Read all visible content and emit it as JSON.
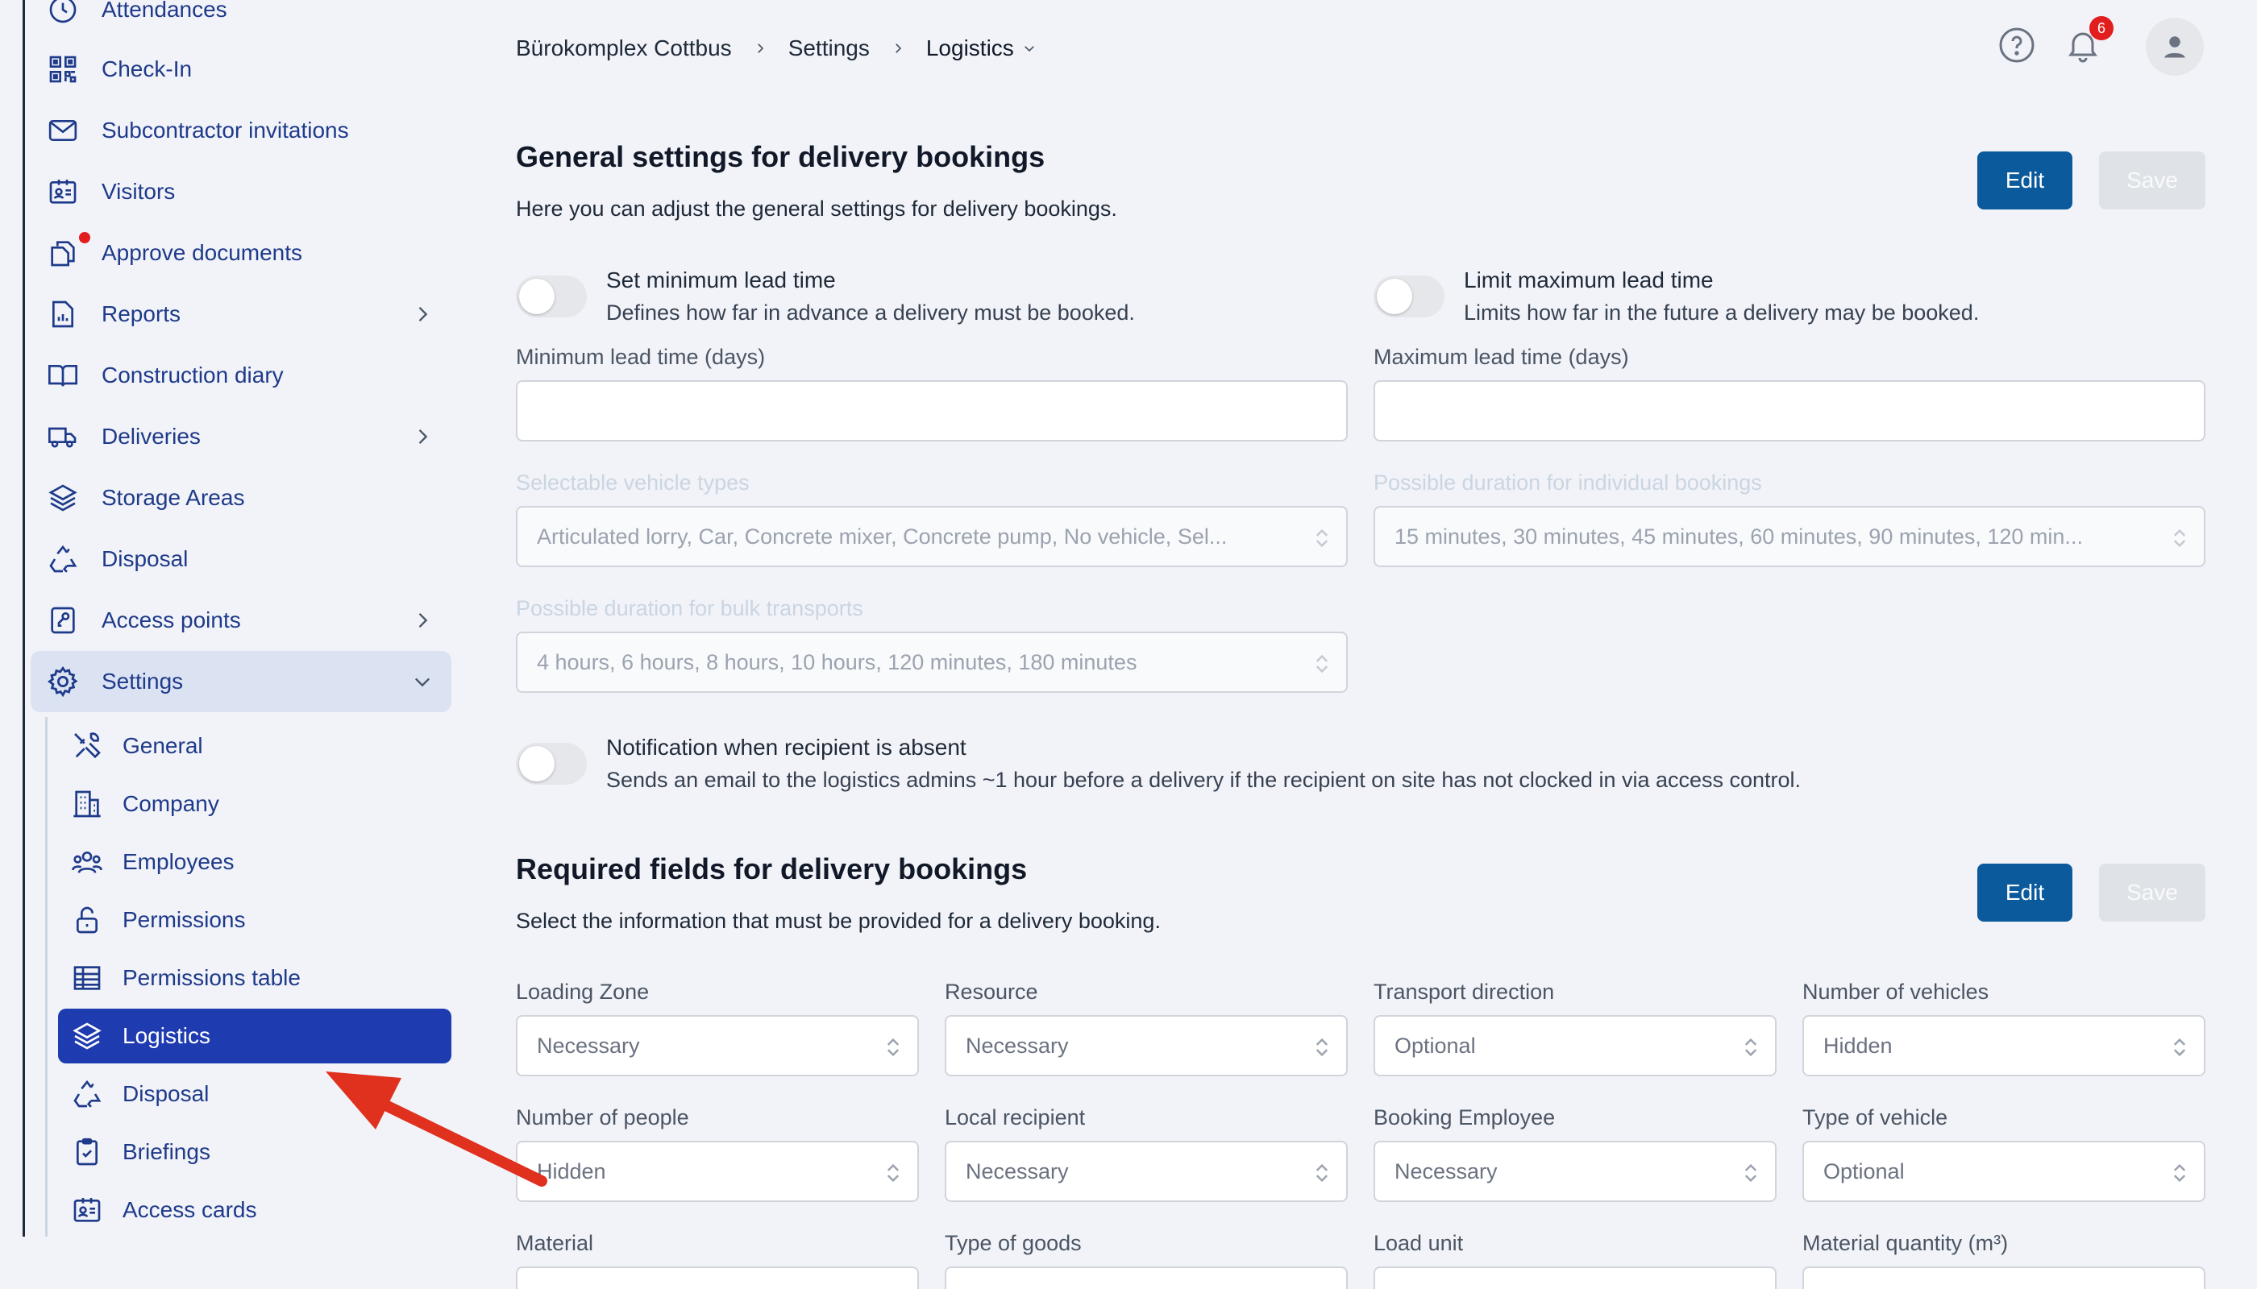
{
  "sidebar": {
    "items": [
      {
        "label": "Attendances"
      },
      {
        "label": "Check-In"
      },
      {
        "label": "Subcontractor invitations"
      },
      {
        "label": "Visitors"
      },
      {
        "label": "Approve documents"
      },
      {
        "label": "Reports"
      },
      {
        "label": "Construction diary"
      },
      {
        "label": "Deliveries"
      },
      {
        "label": "Storage Areas"
      },
      {
        "label": "Disposal"
      },
      {
        "label": "Access points"
      },
      {
        "label": "Settings"
      }
    ],
    "settings_items": [
      {
        "label": "General"
      },
      {
        "label": "Company"
      },
      {
        "label": "Employees"
      },
      {
        "label": "Permissions"
      },
      {
        "label": "Permissions table"
      },
      {
        "label": "Logistics"
      },
      {
        "label": "Disposal"
      },
      {
        "label": "Briefings"
      },
      {
        "label": "Access cards"
      }
    ]
  },
  "breadcrumb": {
    "project": "Bürokomplex Cottbus",
    "settings": "Settings",
    "current": "Logistics"
  },
  "header": {
    "notifications_count": "6"
  },
  "general": {
    "title": "General settings for delivery bookings",
    "description": "Here you can adjust the general settings for delivery bookings.",
    "edit_label": "Edit",
    "save_label": "Save",
    "min_toggle_title": "Set minimum lead time",
    "min_toggle_desc": "Defines how far in advance a delivery must be booked.",
    "max_toggle_title": "Limit maximum lead time",
    "max_toggle_desc": "Limits how far in the future a delivery may be booked.",
    "min_label": "Minimum lead time (days)",
    "max_label": "Maximum lead time (days)",
    "vehicle_types_label": "Selectable vehicle types",
    "vehicle_types_value": "Articulated lorry, Car, Concrete mixer, Concrete pump, No vehicle, Sel...",
    "duration_label": "Possible duration for individual bookings",
    "duration_value": "15 minutes, 30 minutes, 45 minutes, 60 minutes, 90 minutes, 120 min...",
    "bulk_label": "Possible duration for bulk transports",
    "bulk_value": "4 hours, 6 hours, 8 hours, 10 hours, 120 minutes, 180 minutes",
    "absent_toggle_title": "Notification when recipient is absent",
    "absent_toggle_desc": "Sends an email to the logistics admins ~1 hour before a delivery if the recipient on site has not clocked in via access control."
  },
  "required": {
    "title": "Required fields for delivery bookings",
    "description": "Select the information that must be provided for a delivery booking.",
    "edit_label": "Edit",
    "save_label": "Save",
    "fields": [
      {
        "label": "Loading Zone",
        "value": "Necessary"
      },
      {
        "label": "Resource",
        "value": "Necessary"
      },
      {
        "label": "Transport direction",
        "value": "Optional"
      },
      {
        "label": "Number of vehicles",
        "value": "Hidden"
      },
      {
        "label": "Number of people",
        "value": "Hidden"
      },
      {
        "label": "Local recipient",
        "value": "Necessary"
      },
      {
        "label": "Booking Employee",
        "value": "Necessary"
      },
      {
        "label": "Type of vehicle",
        "value": "Optional"
      },
      {
        "label": "Material",
        "value": ""
      },
      {
        "label": "Type of goods",
        "value": ""
      },
      {
        "label": "Load unit",
        "value": ""
      },
      {
        "label": "Material quantity (m³)",
        "value": ""
      }
    ]
  },
  "colors": {
    "accent": "#0a5a9c",
    "selected_nav": "#1e3bb0",
    "nav_text": "#1e3a8a",
    "annotation_arrow": "#e0301e"
  }
}
